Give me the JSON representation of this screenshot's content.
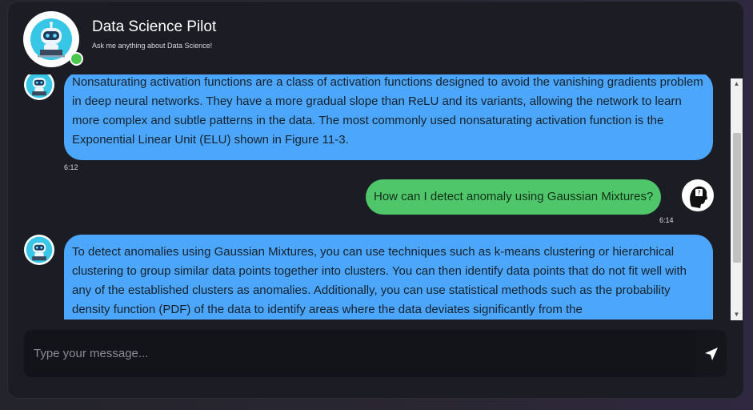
{
  "header": {
    "title": "Data Science Pilot",
    "subtitle": "Ask me anything about Data Science!",
    "status": "online"
  },
  "messages": [
    {
      "sender": "bot",
      "text": "Nonsaturating activation functions are a class of activation functions designed to avoid the vanishing gradients problem in deep neural networks. They have a more gradual slope than ReLU and its variants, allowing the network to learn more complex and subtle patterns in the data. The most commonly used nonsaturating activation function is the Exponential Linear Unit (ELU) shown in Figure 11-3.",
      "time": "6:12"
    },
    {
      "sender": "user",
      "text": "How can I detect anomaly using Gaussian Mixtures?",
      "time": "6:14"
    },
    {
      "sender": "bot",
      "text": "To detect anomalies using Gaussian Mixtures, you can use techniques such as k-means clustering or hierarchical clustering to group similar data points together into clusters. You can then identify data points that do not fit well with any of the established clusters as anomalies. Additionally, you can use statistical methods such as the probability density function (PDF) of the data to identify areas where the data deviates significantly from the",
      "time": ""
    }
  ],
  "composer": {
    "placeholder": "Type your message...",
    "send_icon": "paper-plane-icon"
  },
  "colors": {
    "bot_bubble": "#4ca6fb",
    "user_bubble": "#4fc66a",
    "panel": "#1c1d24",
    "online": "#4cc94c"
  }
}
